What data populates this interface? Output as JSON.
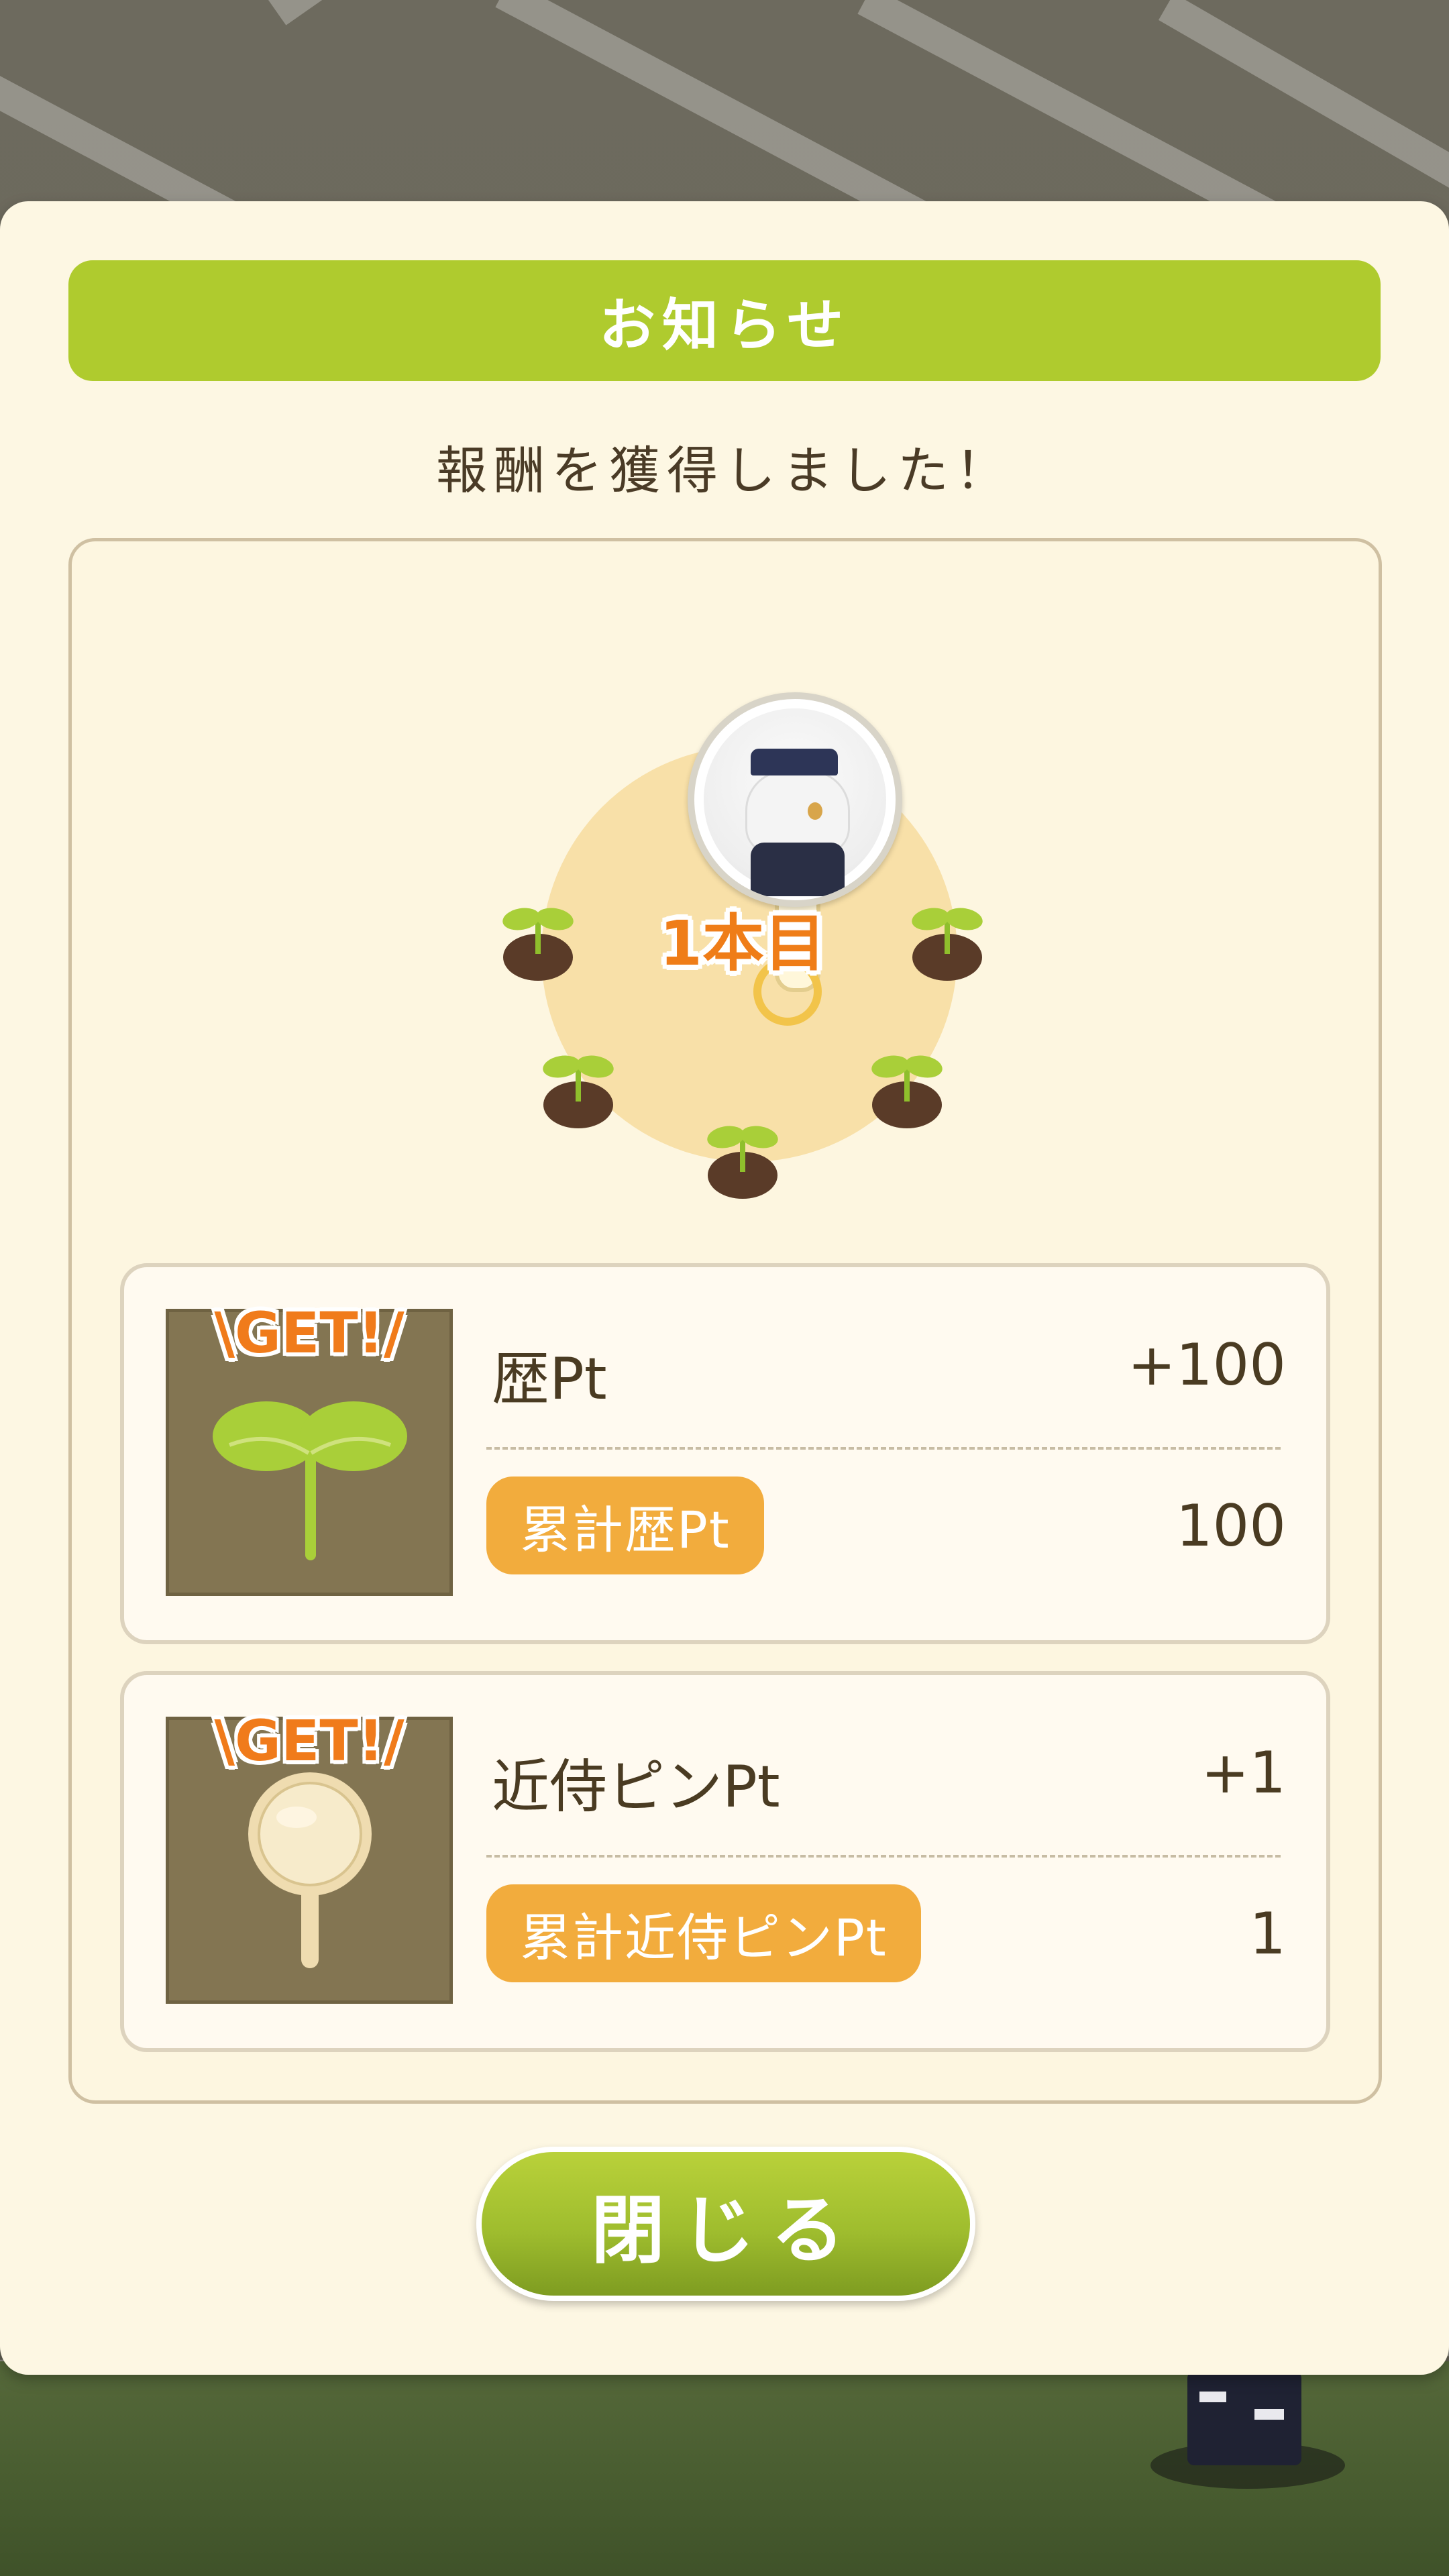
{
  "dialog": {
    "title": "お知らせ",
    "message": "報酬を獲得しました！",
    "tree_count_label": "1本目",
    "close_label": "閉じる"
  },
  "rewards": [
    {
      "icon": "sprout-icon",
      "badge": "\\GET!/",
      "name": "歴Pt",
      "gain": "+100",
      "total_label": "累計歴Pt",
      "total_value": "100"
    },
    {
      "icon": "pin-icon",
      "badge": "\\GET!/",
      "name": "近侍ピンPt",
      "gain": "+1",
      "total_label": "累計近侍ピンPt",
      "total_value": "1"
    }
  ],
  "colors": {
    "title_bar": "#afcb2e",
    "accent_orange": "#f2ac3d",
    "get_orange": "#f07b1b",
    "panel_bg": "#fdf7e3"
  }
}
